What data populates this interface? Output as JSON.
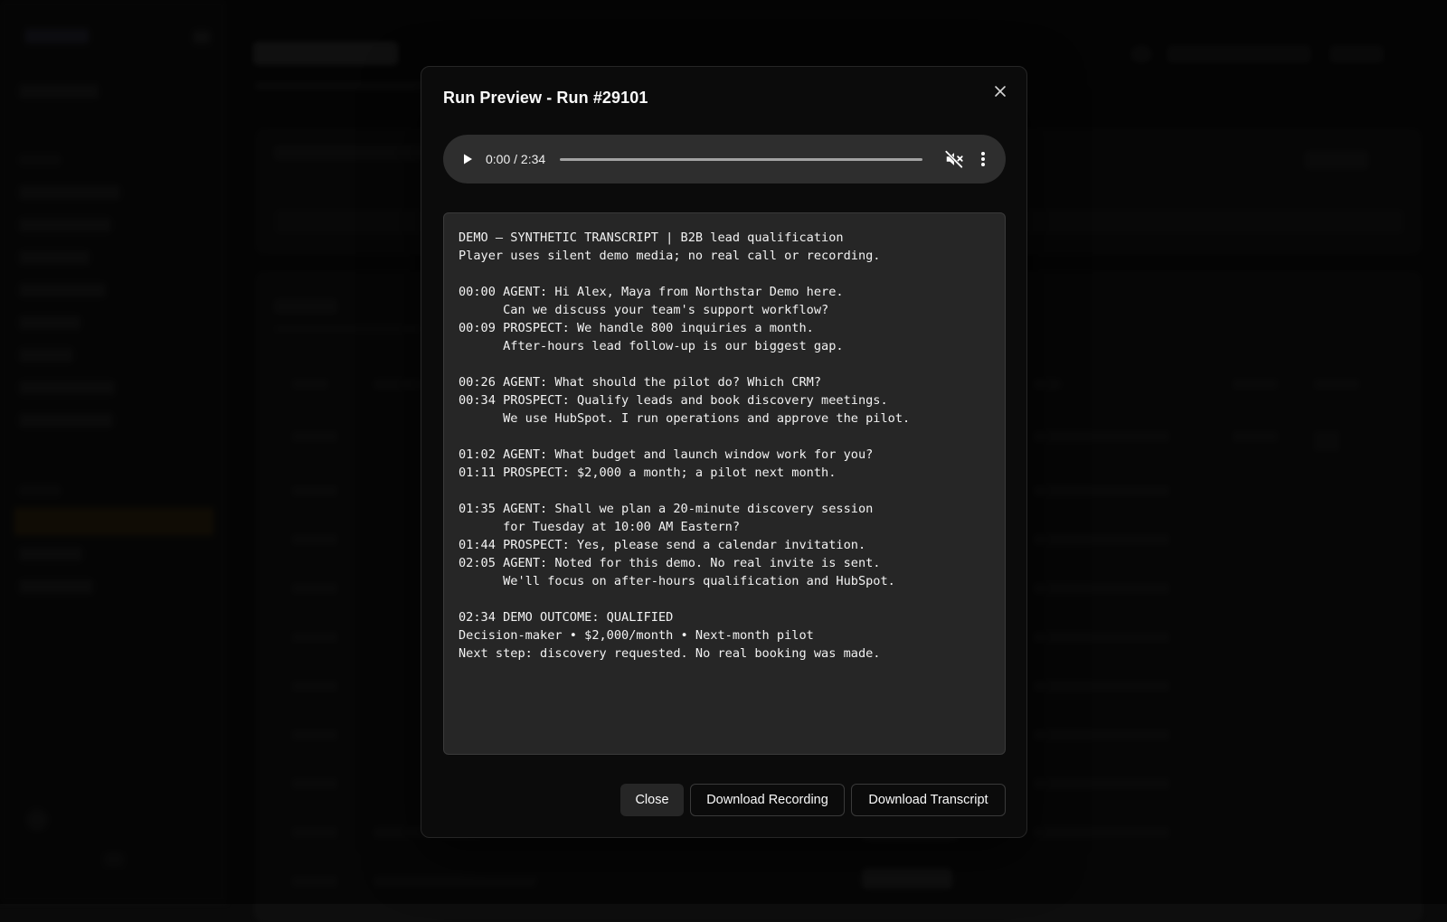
{
  "modal": {
    "title": "Run Preview - Run #29101",
    "close_icon": "close-icon",
    "audio": {
      "current_time": "0:00",
      "duration": "2:34",
      "time_display": "0:00 / 2:34",
      "progress": 0,
      "muted": true,
      "icons": {
        "play": "play-icon",
        "mute": "volume-muted-icon",
        "more": "more-vertical-icon"
      }
    },
    "transcript": "DEMO — SYNTHETIC TRANSCRIPT | B2B lead qualification\nPlayer uses silent demo media; no real call or recording.\n\n00:00 AGENT: Hi Alex, Maya from Northstar Demo here.\n      Can we discuss your team's support workflow?\n00:09 PROSPECT: We handle 800 inquiries a month.\n      After-hours lead follow-up is our biggest gap.\n\n00:26 AGENT: What should the pilot do? Which CRM?\n00:34 PROSPECT: Qualify leads and book discovery meetings.\n      We use HubSpot. I run operations and approve the pilot.\n\n01:02 AGENT: What budget and launch window work for you?\n01:11 PROSPECT: $2,000 a month; a pilot next month.\n\n01:35 AGENT: Shall we plan a 20-minute discovery session\n      for Tuesday at 10:00 AM Eastern?\n01:44 PROSPECT: Yes, please send a calendar invitation.\n02:05 AGENT: Noted for this demo. No real invite is sent.\n      We'll focus on after-hours qualification and HubSpot.\n\n02:34 DEMO OUTCOME: QUALIFIED\nDecision-maker • $2,000/month • Next-month pilot\nNext step: discovery requested. No real booking was made.",
    "buttons": {
      "close": "Close",
      "download_recording": "Download Recording",
      "download_transcript": "Download Transcript"
    }
  },
  "colors": {
    "modal_bg": "#0b0b0b",
    "player_bg": "#2e2e2e",
    "transcript_bg": "#262626",
    "border": "#3a3a3a",
    "sidebar_active": "#3a2a10"
  }
}
